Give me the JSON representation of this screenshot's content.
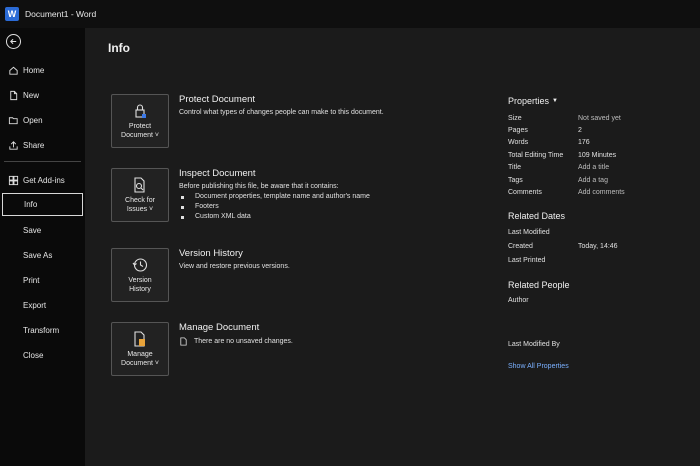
{
  "window": {
    "title": "Document1  -  Word",
    "logo_letter": "W"
  },
  "sidebar": {
    "top_items": [
      {
        "label": "Home",
        "icon": "home-icon"
      },
      {
        "label": "New",
        "icon": "new-document-icon"
      },
      {
        "label": "Open",
        "icon": "folder-open-icon"
      },
      {
        "label": "Share",
        "icon": "share-icon"
      }
    ],
    "get_addins": {
      "label": "Get Add-ins",
      "icon": "addins-grid-icon"
    },
    "bottom_items": [
      "Info",
      "Save",
      "Save As",
      "Print",
      "Export",
      "Transform",
      "Close"
    ],
    "active": "Info"
  },
  "main": {
    "title": "Info",
    "sections": {
      "protect": {
        "tile_line1": "Protect",
        "tile_line2": "Document ˅",
        "title": "Protect Document",
        "desc": "Control what types of changes people can make to this document."
      },
      "inspect": {
        "tile_line1": "Check for",
        "tile_line2": "Issues ˅",
        "title": "Inspect Document",
        "desc": "Before publishing this file, be aware that it contains:",
        "bullets": [
          "Document properties, template name and author's name",
          "Footers",
          "Custom XML data"
        ]
      },
      "version": {
        "tile_line1": "Version",
        "tile_line2": "History",
        "title": "Version History",
        "desc": "View and restore previous versions."
      },
      "manage": {
        "tile_line1": "Manage",
        "tile_line2": "Document ˅",
        "title": "Manage Document",
        "desc": "There are no unsaved changes."
      }
    }
  },
  "properties": {
    "heading": "Properties",
    "rows": [
      {
        "key": "Size",
        "value": "Not saved yet"
      },
      {
        "key": "Pages",
        "value": "2"
      },
      {
        "key": "Words",
        "value": "176"
      },
      {
        "key": "Total Editing Time",
        "value": "109 Minutes"
      },
      {
        "key": "Title",
        "value": "Add a title"
      },
      {
        "key": "Tags",
        "value": "Add a tag"
      },
      {
        "key": "Comments",
        "value": "Add comments"
      }
    ],
    "related_dates": {
      "heading": "Related Dates",
      "last_modified": "Last Modified",
      "created": "Created",
      "created_value": "Today, 14:46",
      "last_printed": "Last Printed"
    },
    "related_people": {
      "heading": "Related People",
      "author": "Author",
      "last_modified_by": "Last Modified By"
    },
    "show_all": "Show All Properties"
  }
}
